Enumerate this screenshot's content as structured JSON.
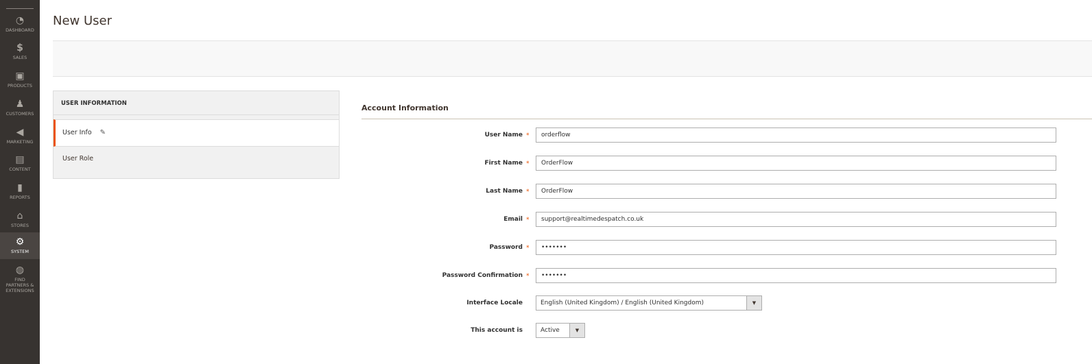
{
  "nav": [
    {
      "label": "DASHBOARD",
      "icon": "dashboard-icon",
      "glyph": "◔"
    },
    {
      "label": "SALES",
      "icon": "dollar-icon",
      "glyph": "$"
    },
    {
      "label": "PRODUCTS",
      "icon": "box-icon",
      "glyph": "▣"
    },
    {
      "label": "CUSTOMERS",
      "icon": "person-icon",
      "glyph": "♟"
    },
    {
      "label": "MARKETING",
      "icon": "megaphone-icon",
      "glyph": "◀"
    },
    {
      "label": "CONTENT",
      "icon": "layout-icon",
      "glyph": "▤"
    },
    {
      "label": "REPORTS",
      "icon": "bar-chart-icon",
      "glyph": "▮"
    },
    {
      "label": "STORES",
      "icon": "store-icon",
      "glyph": "⌂"
    },
    {
      "label": "SYSTEM",
      "icon": "gear-icon",
      "glyph": "⚙"
    },
    {
      "label": "FIND PARTNERS & EXTENSIONS",
      "icon": "extensions-icon",
      "glyph": "◍"
    }
  ],
  "page": {
    "title": "New User"
  },
  "tabs": {
    "heading": "USER INFORMATION",
    "items": [
      {
        "label": "User Info"
      },
      {
        "label": "User Role"
      }
    ]
  },
  "form": {
    "section_title": "Account Information",
    "fields": [
      {
        "label": "User Name",
        "value": "orderflow",
        "required": true
      },
      {
        "label": "First Name",
        "value": "OrderFlow",
        "required": true
      },
      {
        "label": "Last Name",
        "value": "OrderFlow",
        "required": true
      },
      {
        "label": "Email",
        "value": "support@realtimedespatch.co.uk",
        "required": true
      },
      {
        "label": "Password",
        "value": "•••••••",
        "required": true
      },
      {
        "label": "Password Confirmation",
        "value": "•••••••",
        "required": true
      }
    ],
    "locale": {
      "label": "Interface Locale",
      "value": "English (United Kingdom) / English (United Kingdom)"
    },
    "status": {
      "label": "This account is",
      "value": "Active"
    },
    "required_mark": "*",
    "dropdown_arrow": "▼"
  },
  "colors": {
    "accent": "#eb5202",
    "nav_bg": "#373330"
  }
}
